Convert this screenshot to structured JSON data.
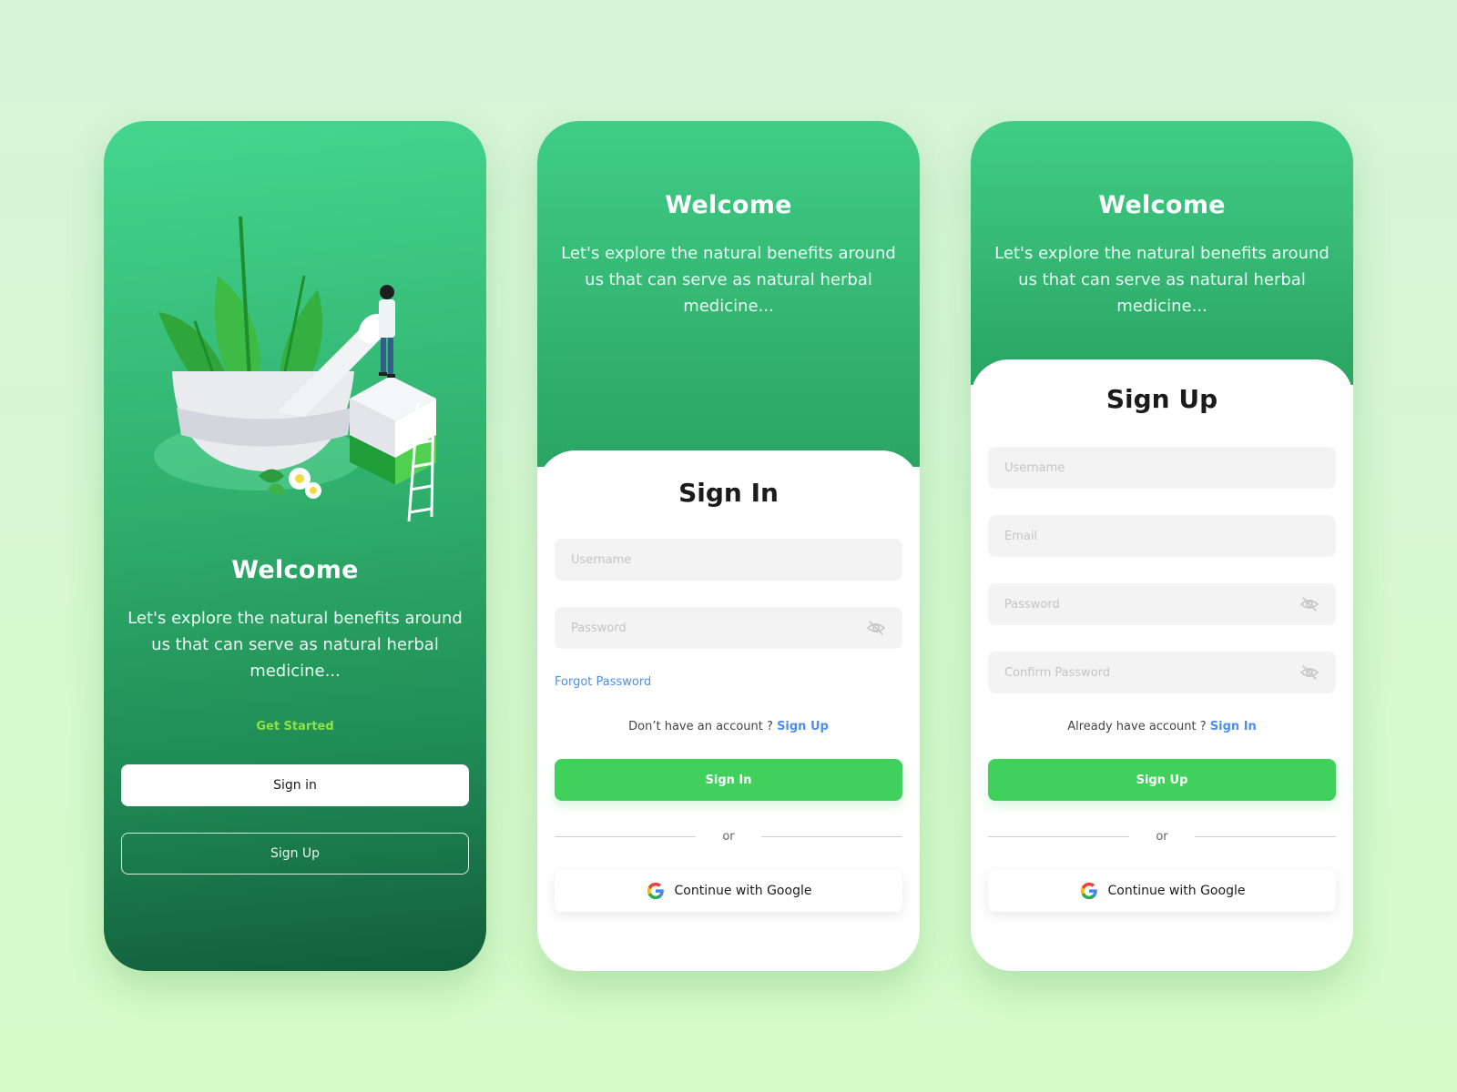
{
  "theme": {
    "background": "#d7f4d9",
    "primary_green": "#40d15c",
    "header_green": "#2fae6c",
    "dark_green": "#125e3b",
    "link_blue": "#4d8df5",
    "get_started_color": "#8ee24a"
  },
  "welcome_screen": {
    "illustration": "mortar-pestle-herbs-with-doctor-illustration",
    "title": "Welcome",
    "description": "Let's explore the natural benefits around us that can serve as natural herbal medicine...",
    "get_started_label": "Get Started",
    "sign_in_label": "Sign in",
    "sign_up_label": "Sign Up"
  },
  "signin_screen": {
    "header_title": "Welcome",
    "header_description": "Let's explore the natural benefits around us that can serve as natural herbal medicine...",
    "title": "Sign In",
    "fields": {
      "username": {
        "placeholder": "Username",
        "value": ""
      },
      "password": {
        "placeholder": "Password",
        "value": "",
        "icon": "eye-off-icon"
      }
    },
    "forgot_password_label": "Forgot Password",
    "account_prompt": "Don’t have an account ?",
    "account_link": "Sign Up",
    "submit_label": "Sign In",
    "divider_label": "or",
    "google_label": "Continue with Google"
  },
  "signup_screen": {
    "header_title": "Welcome",
    "header_description": "Let's explore the natural benefits around us that can serve as natural herbal medicine...",
    "title": "Sign Up",
    "fields": {
      "username": {
        "placeholder": "Username",
        "value": ""
      },
      "email": {
        "placeholder": "Email",
        "value": ""
      },
      "password": {
        "placeholder": "Password",
        "value": "",
        "icon": "eye-off-icon"
      },
      "confirm_password": {
        "placeholder": "Confirm Password",
        "value": "",
        "icon": "eye-off-icon"
      }
    },
    "account_prompt": "Already have account ?",
    "account_link": "Sign In",
    "submit_label": "Sign Up",
    "divider_label": "or",
    "google_label": "Continue with Google"
  }
}
